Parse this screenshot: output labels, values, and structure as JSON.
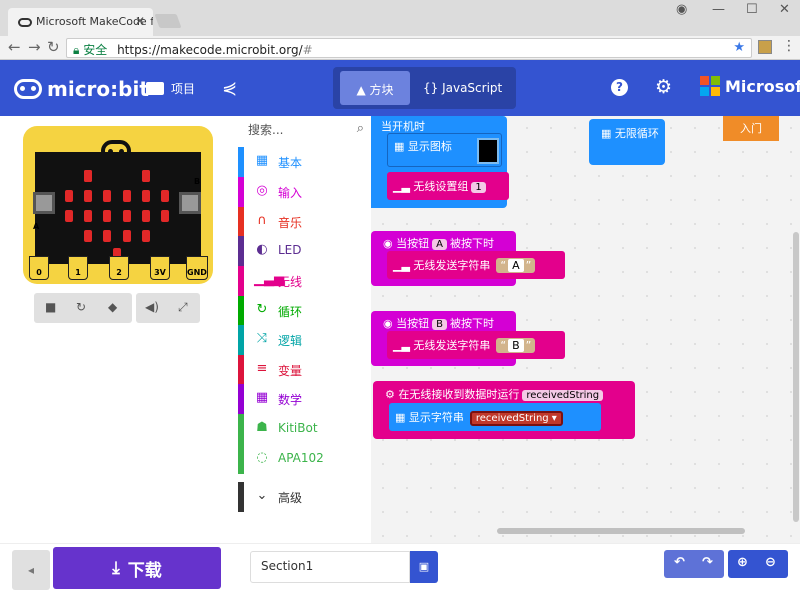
{
  "browser": {
    "tab_title": "Microsoft MakeCode fo",
    "close_glyph": "✕",
    "secure_label": "安全",
    "url_host": "https://makecode.microbit.org/",
    "url_rest": "#"
  },
  "header": {
    "logo_text": "micro:bit",
    "project_label": "项目",
    "blocks_tab": "方块",
    "js_tab": "{} JavaScript",
    "brand": "Microsoft"
  },
  "board": {
    "btn_a": "A",
    "btn_b": "B",
    "pins": [
      "0",
      "1",
      "2",
      "3V",
      "GND"
    ]
  },
  "toolbox": {
    "search_placeholder": "搜索...",
    "categories": [
      {
        "label": "基本",
        "color": "#1e90ff",
        "icon": "grid-icon"
      },
      {
        "label": "输入",
        "color": "#d400d4",
        "icon": "target-icon"
      },
      {
        "label": "音乐",
        "color": "#e63022",
        "icon": "headphones-icon"
      },
      {
        "label": "LED",
        "color": "#5c2d91",
        "icon": "toggle-icon"
      },
      {
        "label": "无线",
        "color": "#e3008c",
        "icon": "signal-icon"
      },
      {
        "label": "循环",
        "color": "#00aa00",
        "icon": "loop-icon"
      },
      {
        "label": "逻辑",
        "color": "#00a4a6",
        "icon": "shuffle-icon"
      },
      {
        "label": "变量",
        "color": "#dc143c",
        "icon": "lines-icon"
      },
      {
        "label": "数学",
        "color": "#9400d3",
        "icon": "calculator-icon"
      },
      {
        "label": "KitiBot",
        "color": "#3cb44b",
        "icon": "robot-icon"
      },
      {
        "label": "APA102",
        "color": "#3cb44b",
        "icon": "ring-icon"
      }
    ],
    "advanced": "高级"
  },
  "workspace": {
    "on_start": "当开机时",
    "show_icon": "显示图标",
    "radio_set_group": "无线设置组",
    "group_value": "1",
    "forever": "无限循环",
    "enter_button": "入门",
    "on_button_a": "当按钮",
    "button_a": "A",
    "pressed": "被按下时",
    "radio_send_string": "无线发送字符串",
    "string_a": "A",
    "on_button_b": "当按钮",
    "button_b": "B",
    "pressed_b": "被按下时",
    "radio_send_string_b": "无线发送字符串",
    "string_b": "B",
    "on_received": "在无线接收到数据时运行",
    "received_var": "receivedString",
    "show_string": "显示字符串",
    "received_var2": "receivedString"
  },
  "bottom": {
    "download": "下载",
    "project_name": "Section1"
  }
}
